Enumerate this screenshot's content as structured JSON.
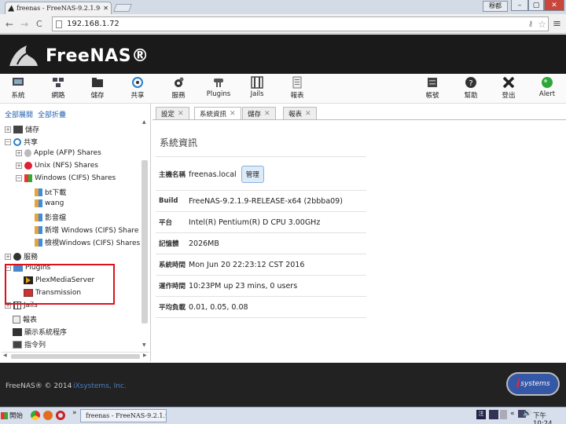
{
  "browser": {
    "tab_title": "freenas - FreeNAS-9.2.1.9-RE",
    "url": "192.168.1.72",
    "window_user": "穆都",
    "min": "–",
    "max": "▢",
    "close": "✕",
    "back": "←",
    "forward": "→",
    "reload": "C"
  },
  "header": {
    "logo_text": "FreeNAS®"
  },
  "toolbar": {
    "system": "系統",
    "network": "網路",
    "storage": "儲存",
    "sharing": "共享",
    "services": "服務",
    "plugins": "Plugins",
    "jails": "Jails",
    "reports": "報表",
    "account": "帳號",
    "help": "幫助",
    "logout": "登出",
    "alert": "Alert"
  },
  "sidebar": {
    "expand_all": "全部展開",
    "collapse_all": "全部折疊",
    "items": {
      "storage": "儲存",
      "sharing": "共享",
      "afp": "Apple (AFP) Shares",
      "nfs": "Unix (NFS) Shares",
      "cifs": "Windows (CIFS) Shares",
      "bt": "bt下載",
      "wang": "wang",
      "media": "影音檔",
      "add_cifs": "新增 Windows (CIFS) Share",
      "view_cifs": "檢視Windows (CIFS) Shares",
      "services": "服務",
      "plugins": "Plugins",
      "plex": "PlexMediaServer",
      "transmission": "Transmission",
      "jails": "Jails",
      "reports": "報表",
      "processes": "顯示系統程序",
      "shell": "指令列"
    }
  },
  "tabs": [
    "設定",
    "系統資訊",
    "儲存",
    "報表"
  ],
  "panel": {
    "title": "系統資訊",
    "rows": [
      {
        "label": "主機名稱",
        "value": "freenas.local",
        "button": "管理"
      },
      {
        "label": "Build",
        "value": "FreeNAS-9.2.1.9-RELEASE-x64 (2bbba09)"
      },
      {
        "label": "平台",
        "value": "Intel(R) Pentium(R) D CPU 3.00GHz"
      },
      {
        "label": "記憶體",
        "value": "2026MB"
      },
      {
        "label": "系統時間",
        "value": "Mon Jun 20 22:23:12 CST 2016"
      },
      {
        "label": "運作時間",
        "value": "10:23PM up 23 mins, 0 users"
      },
      {
        "label": "平均負載",
        "value": "0.01, 0.05, 0.08"
      }
    ]
  },
  "footer": {
    "copyright": "FreeNAS® © 2014",
    "company": "iXsystems, Inc.",
    "badge": "systems"
  },
  "taskbar": {
    "start": "開始",
    "task": "freenas - FreeNAS-9.2.1.9...",
    "clock": "下午 10:24"
  },
  "colors": {
    "highlight_box": "#e0101a",
    "header_bg": "#1a1a1a",
    "footer_link": "#4a7fc1"
  }
}
